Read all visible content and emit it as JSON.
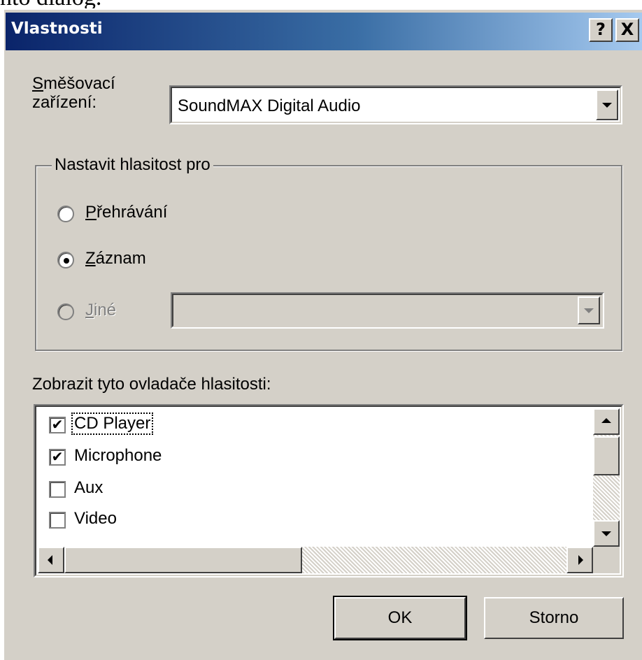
{
  "cut_text": "nto dialog.",
  "dialog": {
    "title": "Vlastnosti",
    "help_label": "?",
    "close_label": "X"
  },
  "mixer": {
    "label_line1_accel": "S",
    "label_line1_rest": "měšovací",
    "label_line2": "zařízení:",
    "selected_device": "SoundMAX Digital Audio"
  },
  "volume_group": {
    "legend": "Nastavit hlasitost pro",
    "options": [
      {
        "accel": "P",
        "rest": "řehrávání",
        "checked": false,
        "enabled": true
      },
      {
        "accel": "Z",
        "rest": "áznam",
        "checked": true,
        "enabled": true
      },
      {
        "accel": "J",
        "rest": "iné",
        "checked": false,
        "enabled": false
      }
    ],
    "other_select_value": ""
  },
  "controls": {
    "label": "Zobrazit tyto ovladače hlasitosti:",
    "items": [
      {
        "label": "CD Player",
        "checked": true
      },
      {
        "label": "Microphone",
        "checked": true
      },
      {
        "label": "Aux",
        "checked": false
      },
      {
        "label": "Video",
        "checked": false
      }
    ],
    "check_glyph": "✔"
  },
  "buttons": {
    "ok": "OK",
    "cancel": "Storno"
  }
}
